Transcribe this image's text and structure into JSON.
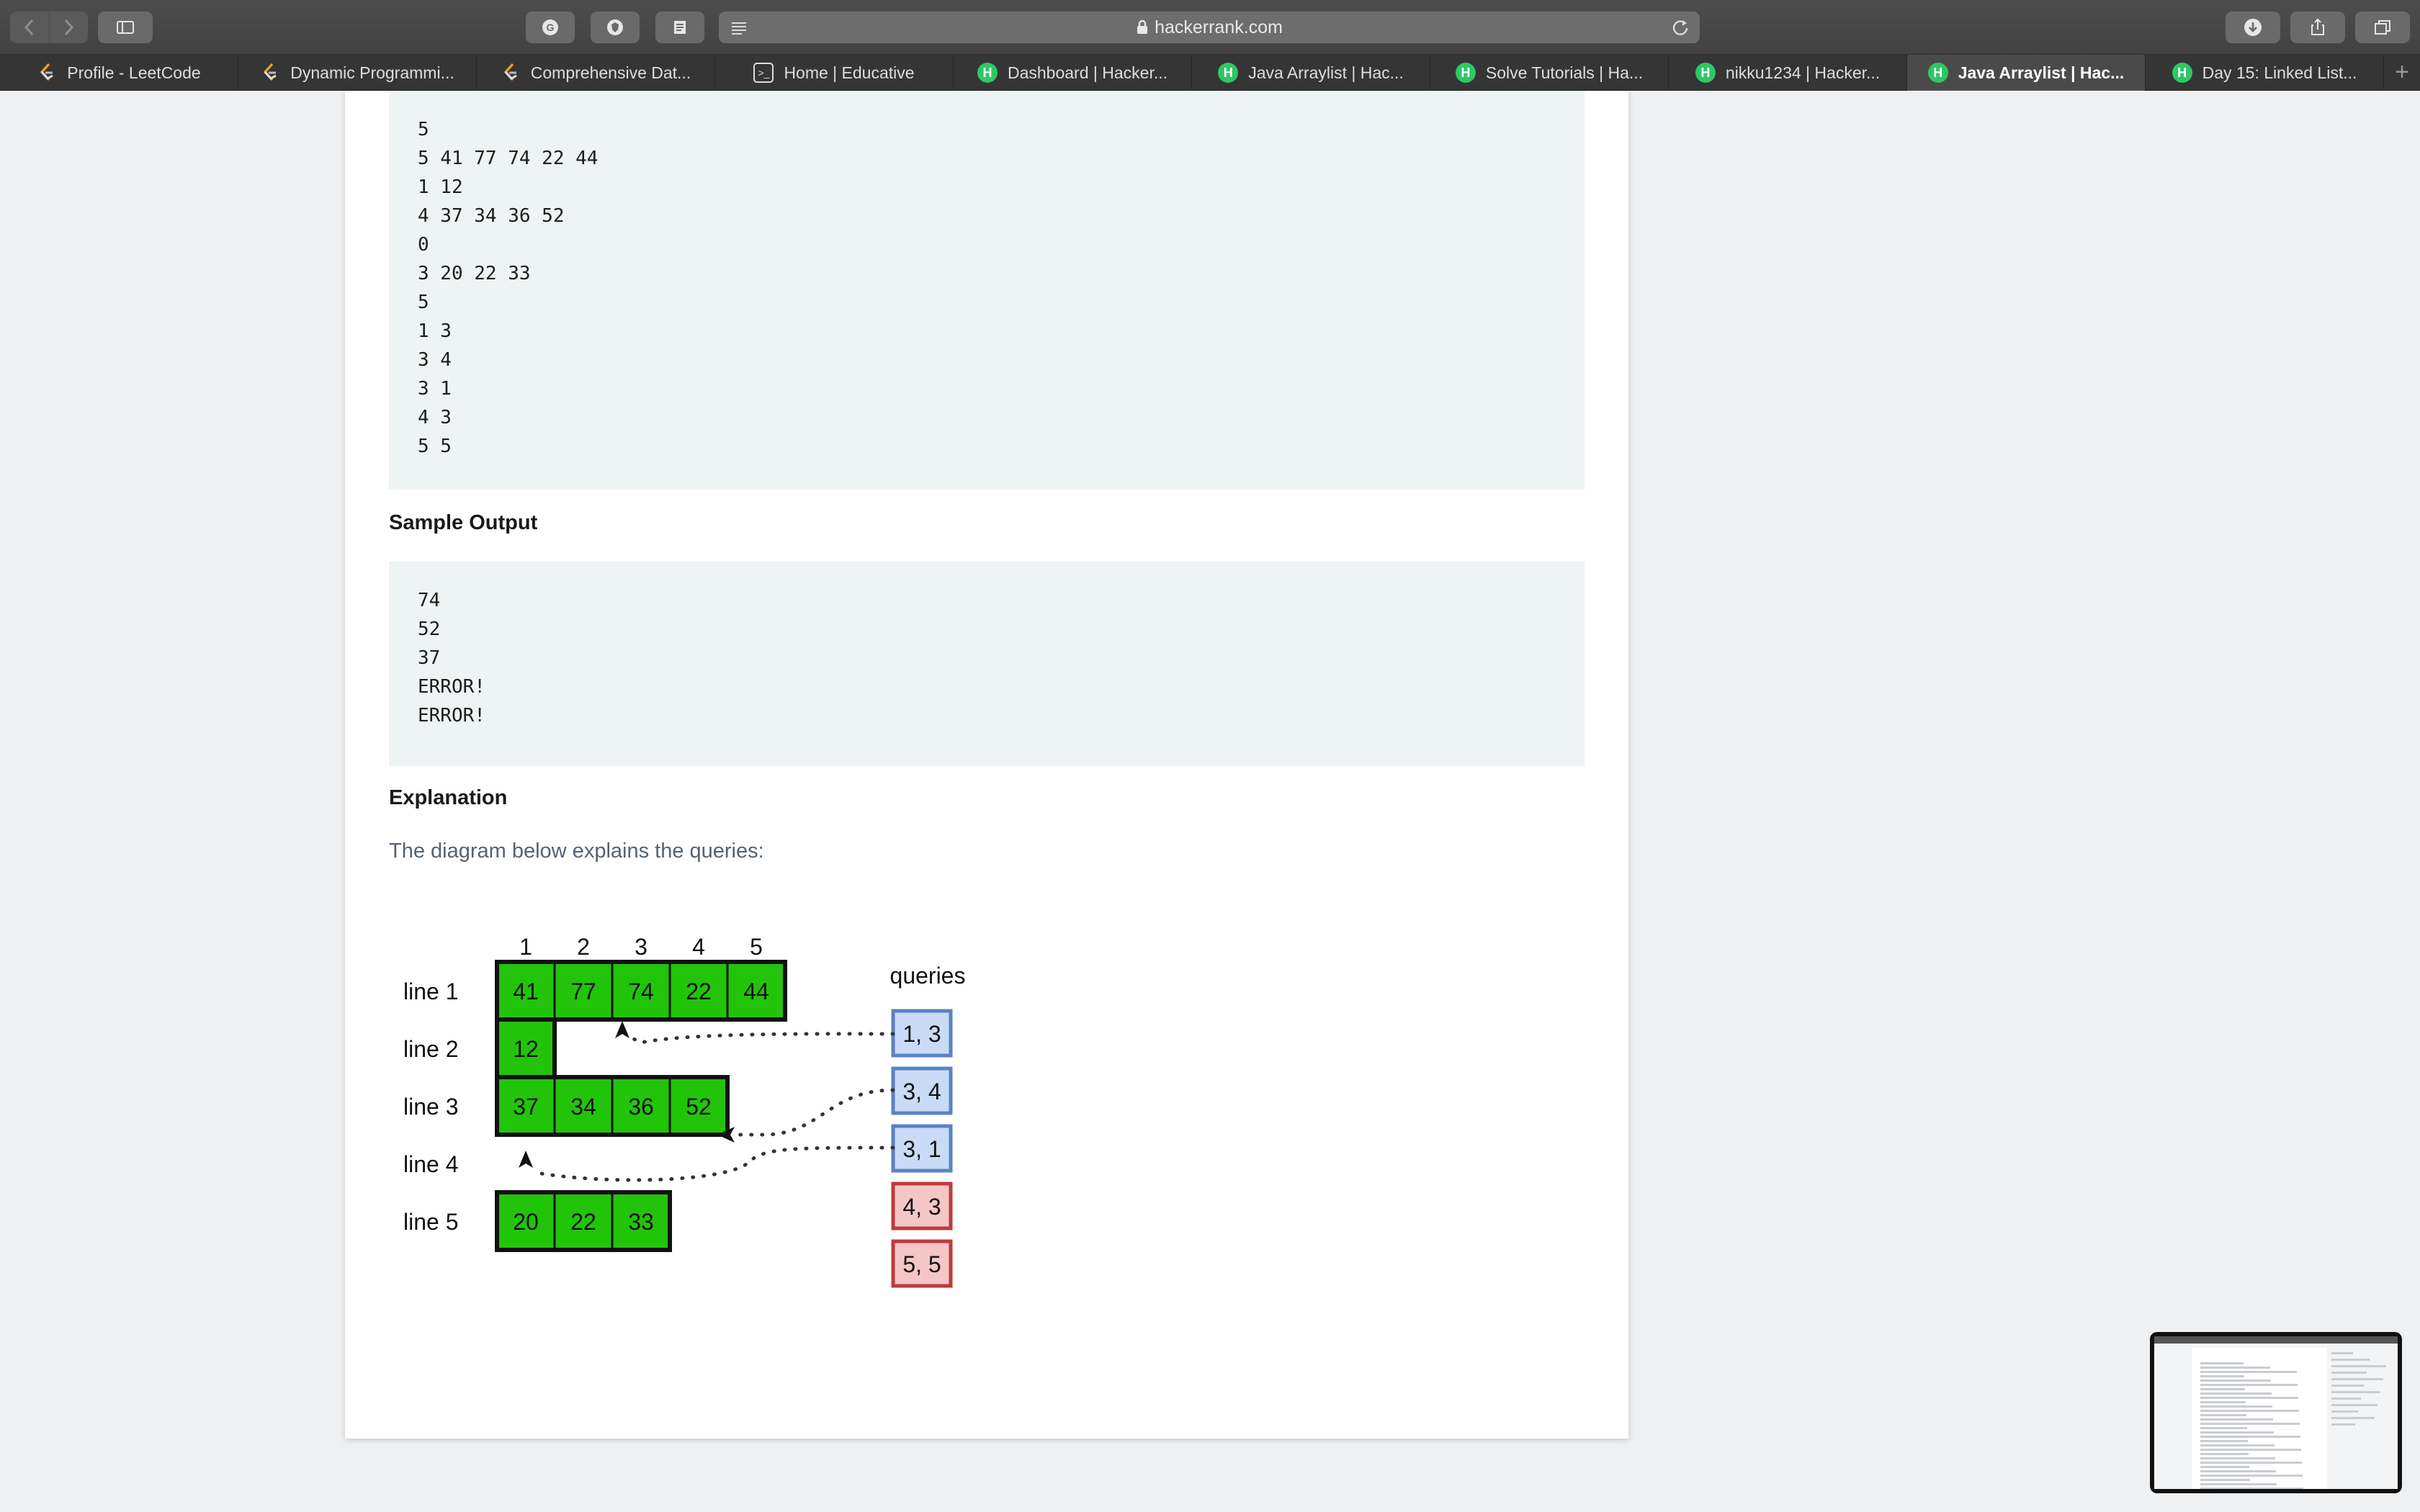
{
  "browser": {
    "url": "hackerrank.com",
    "tabs": [
      {
        "label": "Profile - LeetCode",
        "icon": "leetcode-icon"
      },
      {
        "label": "Dynamic Programmi...",
        "icon": "leetcode-icon"
      },
      {
        "label": "Comprehensive Dat...",
        "icon": "leetcode-icon"
      },
      {
        "label": "Home | Educative",
        "icon": "educative-icon"
      },
      {
        "label": "Dashboard | Hacker...",
        "icon": "hackerrank-icon"
      },
      {
        "label": "Java Arraylist | Hac...",
        "icon": "hackerrank-icon"
      },
      {
        "label": "Solve Tutorials | Ha...",
        "icon": "hackerrank-icon"
      },
      {
        "label": "nikku1234 | Hacker...",
        "icon": "hackerrank-icon"
      },
      {
        "label": "Java Arraylist | Hac...",
        "icon": "hackerrank-icon",
        "active": true
      },
      {
        "label": "Day 15: Linked List...",
        "icon": "hackerrank-icon"
      }
    ],
    "new_tab_label": "+",
    "favicon_letter": "H"
  },
  "content": {
    "sample_input": "5\n5 41 77 74 22 44\n1 12\n4 37 34 36 52\n0\n3 20 22 33\n5\n1 3\n3 4\n3 1\n4 3\n5 5",
    "sample_output_heading": "Sample Output",
    "sample_output": "74\n52\n37\nERROR!\nERROR!",
    "explanation_heading": "Explanation",
    "explanation_text": "The diagram below explains the queries:"
  },
  "diagram": {
    "column_headers": [
      "1",
      "2",
      "3",
      "4",
      "5"
    ],
    "queries_label": "queries",
    "lines": [
      {
        "label": "line 1",
        "values": [
          "41",
          "77",
          "74",
          "22",
          "44"
        ]
      },
      {
        "label": "line 2",
        "values": [
          "12"
        ]
      },
      {
        "label": "line 3",
        "values": [
          "37",
          "34",
          "36",
          "52"
        ]
      },
      {
        "label": "line 4",
        "values": []
      },
      {
        "label": "line 5",
        "values": [
          "20",
          "22",
          "33"
        ]
      }
    ],
    "queries": [
      {
        "label": "1, 3",
        "valid": true
      },
      {
        "label": "3, 4",
        "valid": true
      },
      {
        "label": "3, 1",
        "valid": true
      },
      {
        "label": "4, 3",
        "valid": false
      },
      {
        "label": "5, 5",
        "valid": false
      }
    ],
    "colors": {
      "cell_fill": "#22c40a",
      "cell_border": "#111111",
      "query_valid_fill": "#c9dbf7",
      "query_valid_border": "#5b82c4",
      "query_invalid_fill": "#f4c6c6",
      "query_invalid_border": "#c0393b"
    }
  }
}
